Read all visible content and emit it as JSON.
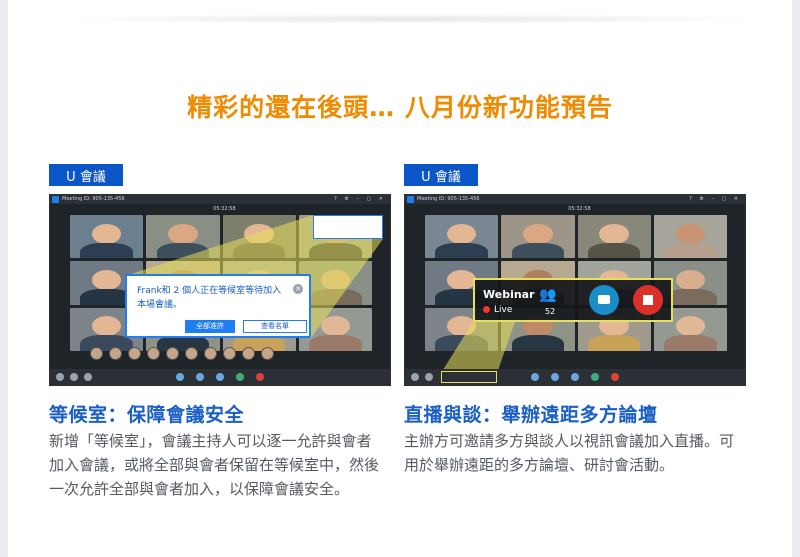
{
  "headline": "精彩的還在後頭… 八月份新功能預告",
  "colors": {
    "accent_orange": "#f08a00",
    "brand_blue": "#0a56c9",
    "highlight_yellow": "#e7e05a",
    "live_red": "#f0382b"
  },
  "cards": [
    {
      "badge": "U 會議",
      "title": "等候室：保障會議安全",
      "text": "新增「等候室」，會議主持人可以逐一允許與會者加入會議，或將全部與會者保留在等候室中，然後一次允許全部與會者加入，以保障會議安全。",
      "screenshot": {
        "titlebar": "Meeting ID: 905-135-456",
        "time": "05:32:58",
        "popup_message": "Frank和 2 個人正在等候室等待加入本場會議。",
        "popup_btn_admit": "全部准許",
        "popup_btn_view": "查看名單",
        "icons": [
          "u-meeting-logo",
          "close-icon",
          "mic-icon",
          "camera-icon",
          "speaker-icon",
          "people-icon",
          "chat-icon",
          "share-icon",
          "end-call-icon"
        ]
      }
    },
    {
      "badge": "U 會議",
      "title": "直播與談：舉辦遠距多方論壇",
      "text": "主辦方可邀請多方與談人以視訊會議加入直播。可用於舉辦遠距的多方論壇、研討會活動。",
      "screenshot": {
        "titlebar": "Meeting ID: 905-135-456",
        "time": "05:32:58",
        "webinar_label": "Webinar",
        "live_label": "Live",
        "viewer_count": "52",
        "icons": [
          "u-meeting-logo",
          "people-icon",
          "chat-icon",
          "stop-icon",
          "mic-icon",
          "camera-icon",
          "end-call-icon"
        ]
      }
    }
  ]
}
